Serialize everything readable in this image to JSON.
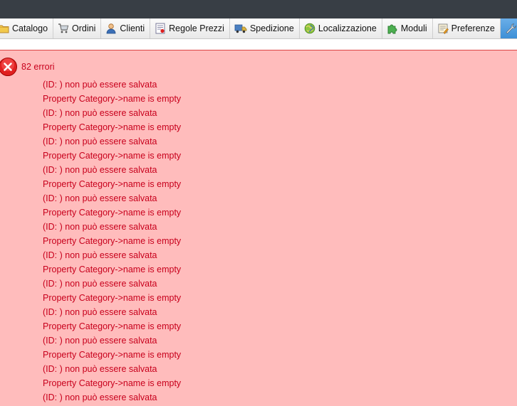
{
  "nav": {
    "tabs": [
      {
        "label": "Catalogo",
        "icon": "folder-icon"
      },
      {
        "label": "Ordini",
        "icon": "cart-icon"
      },
      {
        "label": "Clienti",
        "icon": "user-icon"
      },
      {
        "label": "Regole Prezzi",
        "icon": "price-rules-icon"
      },
      {
        "label": "Spedizione",
        "icon": "truck-icon"
      },
      {
        "label": "Localizzazione",
        "icon": "globe-icon"
      },
      {
        "label": "Moduli",
        "icon": "puzzle-icon"
      },
      {
        "label": "Preferenze",
        "icon": "preferences-icon"
      },
      {
        "label": "",
        "icon": "wrench-icon"
      }
    ]
  },
  "errors": {
    "count_label": "82 errori",
    "messages": [
      "(ID: ) non può essere salvata",
      "Property Category->name is empty",
      "(ID: ) non può essere salvata",
      "Property Category->name is empty",
      "(ID: ) non può essere salvata",
      "Property Category->name is empty",
      "(ID: ) non può essere salvata",
      "Property Category->name is empty",
      "(ID: ) non può essere salvata",
      "Property Category->name is empty",
      "(ID: ) non può essere salvata",
      "Property Category->name is empty",
      "(ID: ) non può essere salvata",
      "Property Category->name is empty",
      "(ID: ) non può essere salvata",
      "Property Category->name is empty",
      "(ID: ) non può essere salvata",
      "Property Category->name is empty",
      "(ID: ) non può essere salvata",
      "Property Category->name is empty",
      "(ID: ) non può essere salvata",
      "Property Category->name is empty",
      "(ID: ) non può essere salvata"
    ]
  },
  "colors": {
    "topbar": "#383e45",
    "error_background": "#ffbcbc",
    "error_text": "#c8001c",
    "error_icon": "#e02020",
    "active_tab": "#3d8fd6"
  }
}
